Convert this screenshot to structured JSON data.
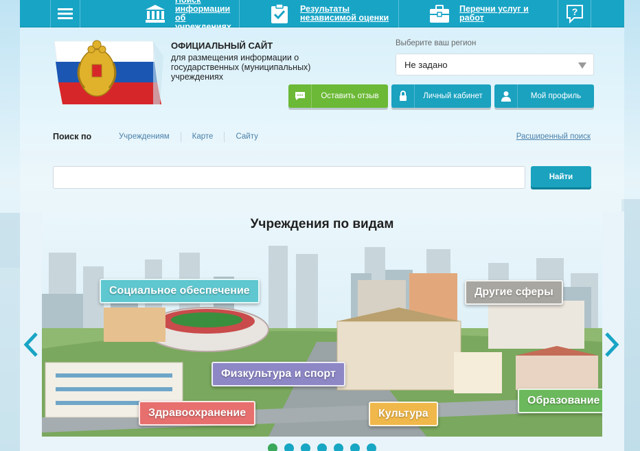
{
  "topnav": {
    "items": [
      {
        "label": "Поиск информации об учреждениях",
        "icon": "institution-icon"
      },
      {
        "label": "Результаты независимой оценки",
        "icon": "checklist-icon"
      },
      {
        "label": "Перечни услуг и работ",
        "icon": "briefcase-icon"
      }
    ],
    "menu_icon": "hamburger-menu-icon",
    "help_icon": "help-question-icon"
  },
  "header": {
    "title": "ОФИЦИАЛЬНЫЙ САЙТ",
    "subtitle": "для размещения информации о государственных (муниципальных) учреждениях",
    "region_label": "Выберите ваш регион",
    "region_value": "Не задано",
    "buttons": {
      "feedback": "Оставить отзыв",
      "cabinet": "Личный кабинет",
      "profile": "Мой профиль"
    }
  },
  "search": {
    "by_label": "Поиск по",
    "tabs": [
      "Учреждениям",
      "Карте",
      "Сайту"
    ],
    "advanced": "Расширенный поиск",
    "input_value": "",
    "button": "Найти"
  },
  "carousel": {
    "title": "Учреждения по видам",
    "categories": {
      "social": "Социальное обеспечение",
      "other": "Другие сферы",
      "sport": "Физкультура и спорт",
      "health": "Здравоохранение",
      "culture": "Культура",
      "education": "Образование"
    },
    "dots_count": 7,
    "active_dot": 0
  },
  "colors": {
    "primary": "#18a4c5",
    "green": "#6bb936",
    "social": "#5ec7cf",
    "other": "#a7a6a0",
    "sport": "#8d87c6",
    "health": "#e7706f",
    "culture": "#f0b84a",
    "education": "#6bb95c"
  }
}
